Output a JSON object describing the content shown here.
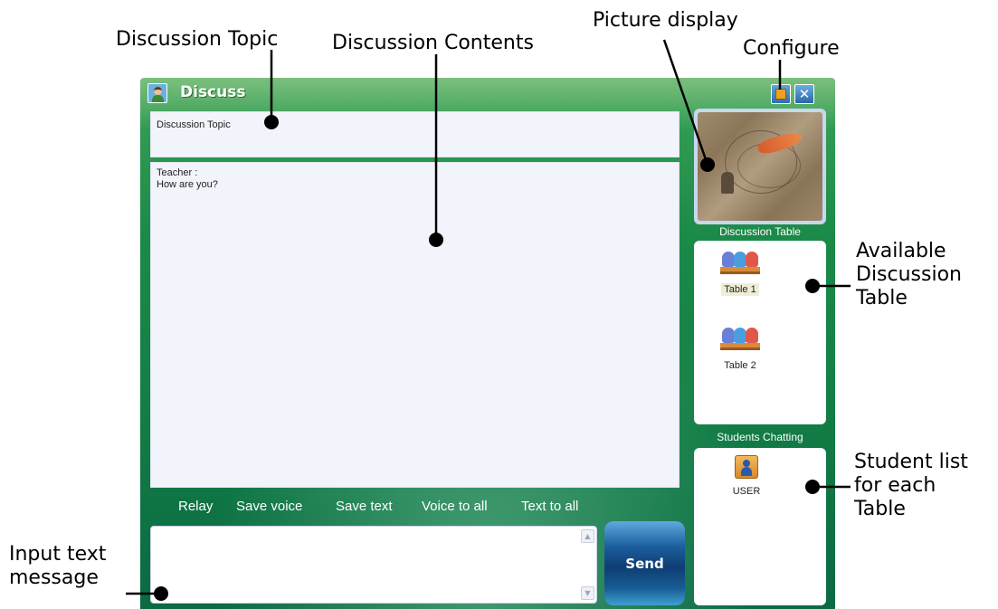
{
  "annotations": {
    "discussion_topic": "Discussion Topic",
    "discussion_contents": "Discussion Contents",
    "picture_display": "Picture display",
    "configure": "Configure",
    "available_table": [
      "Available",
      "Discussion",
      "Table"
    ],
    "student_list": [
      "Student list",
      "for each",
      "Table"
    ],
    "input_text": [
      "Input text",
      "message"
    ]
  },
  "window": {
    "title": "Discuss",
    "close_glyph": "✕"
  },
  "topic": {
    "text": "Discussion Topic"
  },
  "contents": {
    "lines": [
      "Teacher :",
      "How are you?"
    ]
  },
  "toolbar": {
    "relay": "Relay",
    "save_voice": "Save voice",
    "save_text": "Save text",
    "voice_to_all": "Voice to all",
    "text_to_all": "Text to all"
  },
  "input": {
    "scroll_up": "▲",
    "scroll_down": "▼"
  },
  "send": {
    "label": "Send"
  },
  "discussion_table": {
    "title": "Discussion Table",
    "tables": [
      {
        "label": "Table 1",
        "selected": true
      },
      {
        "label": "Table 2",
        "selected": false
      }
    ]
  },
  "students_chatting": {
    "title": "Students  Chatting",
    "users": [
      {
        "label": "USER"
      }
    ]
  },
  "colors": {
    "window_green": "#137f45",
    "pane_bg": "#f1f4fa",
    "send_blue": "#0e3d73"
  }
}
